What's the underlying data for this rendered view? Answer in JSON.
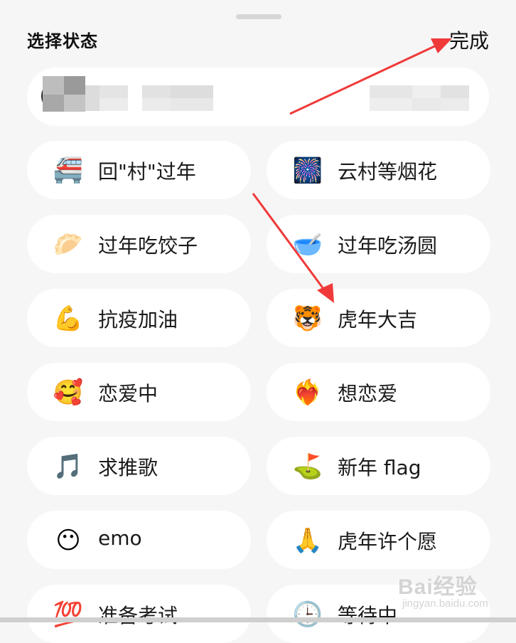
{
  "header": {
    "title": "选择状态",
    "done_label": "完成"
  },
  "statuses": [
    {
      "icon": "monorail-icon",
      "emoji": "🚝",
      "label": "回\"村\"过年"
    },
    {
      "icon": "fireworks-icon",
      "emoji": "🎆",
      "label": "云村等烟花"
    },
    {
      "icon": "dumpling-icon",
      "emoji": "🥟",
      "label": "过年吃饺子"
    },
    {
      "icon": "bowl-icon",
      "emoji": "🥣",
      "label": "过年吃汤圆"
    },
    {
      "icon": "flexed-biceps-icon",
      "emoji": "💪",
      "label": "抗疫加油"
    },
    {
      "icon": "tiger-face-icon",
      "emoji": "🐯",
      "label": "虎年大吉"
    },
    {
      "icon": "smiling-face-hearts-icon",
      "emoji": "🥰",
      "label": "恋爱中"
    },
    {
      "icon": "heart-on-fire-icon",
      "emoji": "❤️‍🔥",
      "label": "想恋爱"
    },
    {
      "icon": "musical-note-icon",
      "emoji": "🎵",
      "label": "求推歌"
    },
    {
      "icon": "golf-flag-icon",
      "emoji": "⛳",
      "label": "新年 flag"
    },
    {
      "icon": "no-mouth-face-icon",
      "emoji": "😶",
      "label": "emo"
    },
    {
      "icon": "folded-hands-icon",
      "emoji": "🙏",
      "label": "虎年许个愿"
    },
    {
      "icon": "hundred-points-icon",
      "emoji": "💯",
      "label": "准备考试"
    },
    {
      "icon": "clock-icon",
      "emoji": "🕒",
      "label": "等待中"
    }
  ],
  "annotations": {
    "arrow_color": "#f03a3a"
  },
  "watermark": {
    "main": "Bai经验",
    "sub": "jingyan.baidu.com"
  }
}
